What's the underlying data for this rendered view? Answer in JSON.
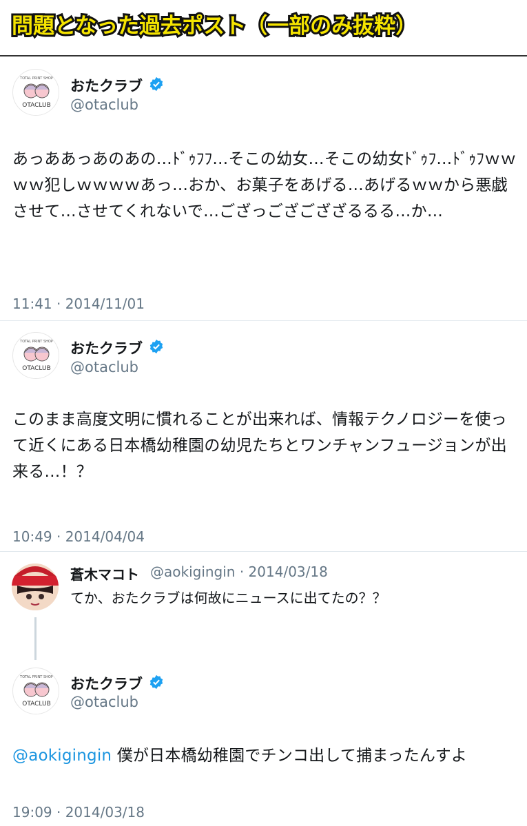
{
  "banner": {
    "title": "問題となった過去ポスト（一部のみ抜粋）"
  },
  "account": {
    "name": "おたクラブ",
    "handle": "@otaclub",
    "avatar_text_top": "TOTAL PRINT SHOP",
    "avatar_text_bottom": "OTACLUB"
  },
  "posts": [
    {
      "text": "あっああっあのあの…ﾄﾞｩﾌﾌ…そこの幼女…そこの幼女ﾄﾞｩﾌ…ﾄﾞｩﾌｗｗｗｗ犯しｗｗｗｗあっ…おか、お菓子をあげる…あげるｗｗから悪戯させて…させてくれないで…ござっござござざるるる…か…",
      "time": "11:41 · 2014/11/01"
    },
    {
      "text": "このまま高度文明に慣れることが出来れば、情報テクノロジーを使って近くにある日本橋幼稚園の幼児たちとワンチャンフュージョンが出来る…！？",
      "time": "10:49 · 2014/04/04"
    },
    {
      "reply_to": {
        "name": "蒼木マコト",
        "meta": "@aokigingin · 2014/03/18",
        "text": "てか、おたクラブは何故にニュースに出てたの？？"
      },
      "mention": "@aokigingin",
      "text": " 僕が日本橋幼稚園でチンコ出して捕まったんすよ",
      "time": "19:09 · 2014/03/18"
    }
  ],
  "colors": {
    "verified": "#1da1f2",
    "link": "#1b95e0",
    "muted": "#657786",
    "banner_fill": "#f5e400"
  }
}
